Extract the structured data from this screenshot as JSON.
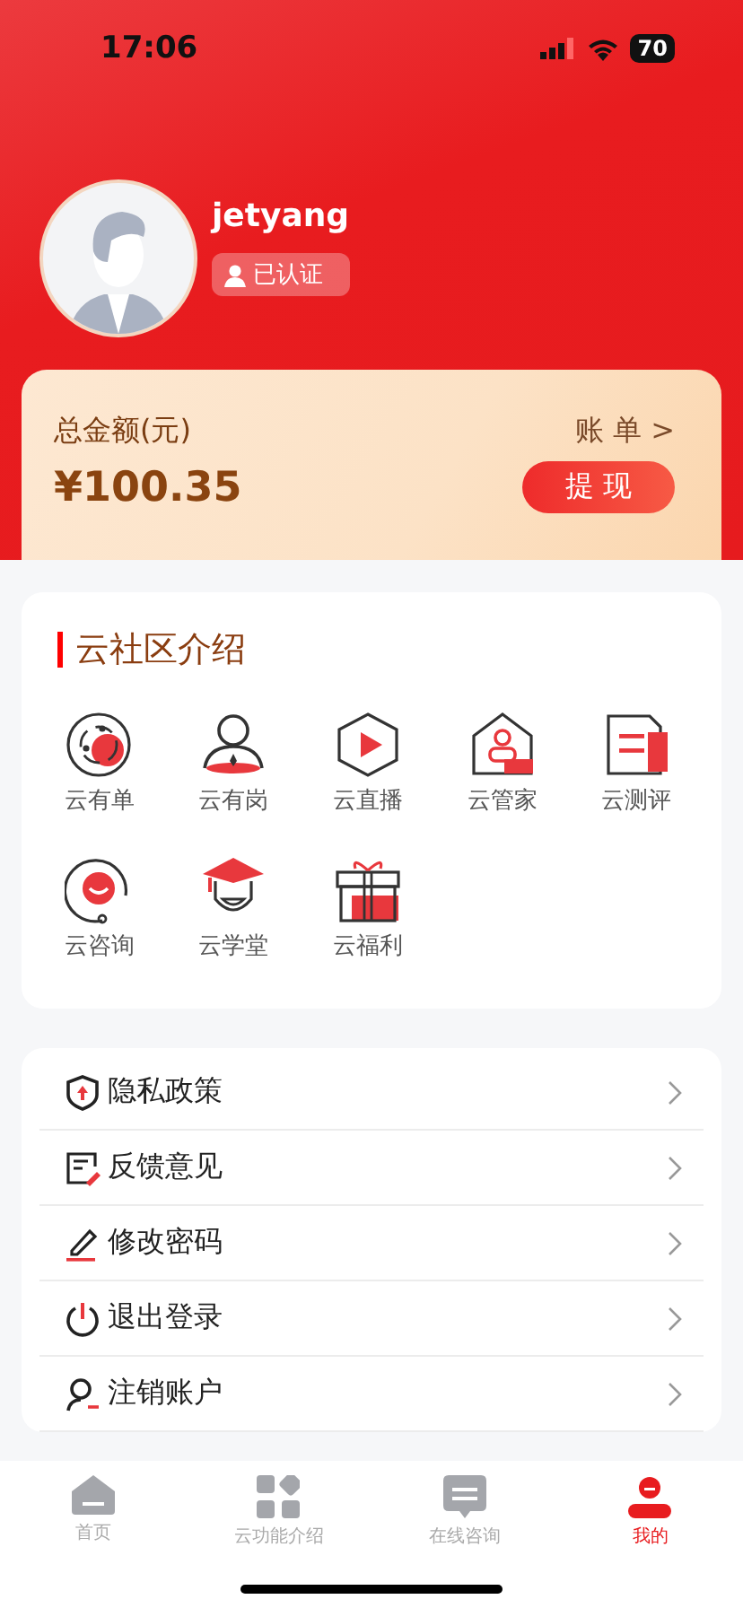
{
  "status_bar": {
    "time": "17:06",
    "battery": "70"
  },
  "profile": {
    "username": "jetyang",
    "badge": "已认证"
  },
  "balance": {
    "label": "总金额(元)",
    "amount": "¥100.35",
    "bill_link": "账 单 >",
    "withdraw_button": "提 现"
  },
  "community": {
    "title": "云社区介绍",
    "items": [
      {
        "label": "云有单"
      },
      {
        "label": "云有岗"
      },
      {
        "label": "云直播"
      },
      {
        "label": "云管家"
      },
      {
        "label": "云测评"
      },
      {
        "label": "云咨询"
      },
      {
        "label": "云学堂"
      },
      {
        "label": "云福利"
      }
    ]
  },
  "menu": [
    {
      "label": "隐私政策"
    },
    {
      "label": "反馈意见"
    },
    {
      "label": "修改密码"
    },
    {
      "label": "退出登录"
    },
    {
      "label": "注销账户"
    }
  ],
  "tab_bar": [
    {
      "label": "首页",
      "selected": false
    },
    {
      "label": "云功能介绍",
      "selected": false
    },
    {
      "label": "在线咨询",
      "selected": false
    },
    {
      "label": "我的",
      "selected": true
    }
  ]
}
